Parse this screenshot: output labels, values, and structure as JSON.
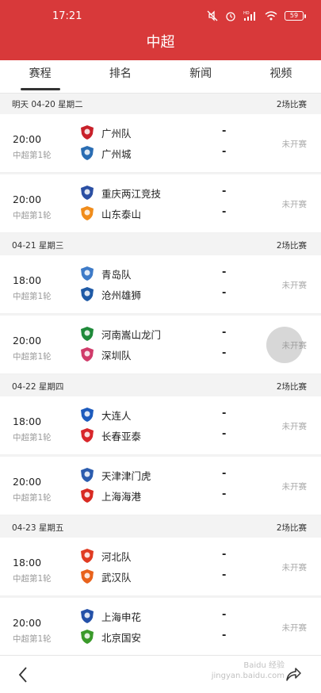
{
  "status": {
    "time": "17:21",
    "battery": "59",
    "signal": "HD"
  },
  "nav": {
    "title": "中超"
  },
  "tabs": [
    {
      "label": "赛程",
      "active": true
    },
    {
      "label": "排名",
      "active": false
    },
    {
      "label": "新闻",
      "active": false
    },
    {
      "label": "视频",
      "active": false
    }
  ],
  "days": [
    {
      "date": "明天 04-20 星期二",
      "count": "2场比赛",
      "matches": [
        {
          "time": "20:00",
          "round": "中超第1轮",
          "home": "广州队",
          "away": "广州城",
          "home_score": "-",
          "away_score": "-",
          "status": "未开赛"
        },
        {
          "time": "20:00",
          "round": "中超第1轮",
          "home": "重庆两江竞技",
          "away": "山东泰山",
          "home_score": "-",
          "away_score": "-",
          "status": "未开赛"
        }
      ]
    },
    {
      "date": "04-21 星期三",
      "count": "2场比赛",
      "matches": [
        {
          "time": "18:00",
          "round": "中超第1轮",
          "home": "青岛队",
          "away": "沧州雄狮",
          "home_score": "-",
          "away_score": "-",
          "status": "未开赛"
        },
        {
          "time": "20:00",
          "round": "中超第1轮",
          "home": "河南嵩山龙门",
          "away": "深圳队",
          "home_score": "-",
          "away_score": "-",
          "status": "未开赛"
        }
      ]
    },
    {
      "date": "04-22 星期四",
      "count": "2场比赛",
      "matches": [
        {
          "time": "18:00",
          "round": "中超第1轮",
          "home": "大连人",
          "away": "长春亚泰",
          "home_score": "-",
          "away_score": "-",
          "status": "未开赛"
        },
        {
          "time": "20:00",
          "round": "中超第1轮",
          "home": "天津津门虎",
          "away": "上海海港",
          "home_score": "-",
          "away_score": "-",
          "status": "未开赛"
        }
      ]
    },
    {
      "date": "04-23 星期五",
      "count": "2场比赛",
      "matches": [
        {
          "time": "18:00",
          "round": "中超第1轮",
          "home": "河北队",
          "away": "武汉队",
          "home_score": "-",
          "away_score": "-",
          "status": "未开赛"
        },
        {
          "time": "20:00",
          "round": "中超第1轮",
          "home": "上海申花",
          "away": "北京国安",
          "home_score": "-",
          "away_score": "-",
          "status": "未开赛"
        }
      ]
    }
  ],
  "logo_colors": {
    "广州队": "#c8202a",
    "广州城": "#2a6db3",
    "重庆两江竞技": "#2b4fa3",
    "山东泰山": "#f08c1b",
    "青岛队": "#3e7bc8",
    "沧州雄狮": "#1f5aa6",
    "河南嵩山龙门": "#1f8a3a",
    "深圳队": "#d03b6a",
    "大连人": "#1d5bbd",
    "长春亚泰": "#d8262b",
    "天津津门虎": "#2b5cae",
    "上海海港": "#d82a22",
    "河北队": "#e03b22",
    "武汉队": "#e8621c",
    "上海申花": "#2451a8",
    "北京国安": "#3a9a2a"
  },
  "bottom": {
    "watermark_line1": "Baidu 经验",
    "watermark_line2": "jingyan.baidu.com"
  }
}
